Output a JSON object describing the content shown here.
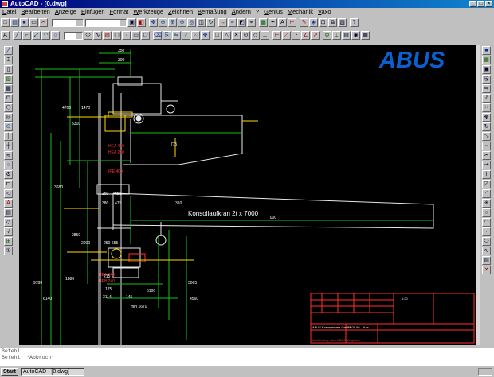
{
  "window": {
    "title": "AutoCAD - [0.dwg]"
  },
  "menu": [
    "Datei",
    "Bearbeiten",
    "Anzeige",
    "Einfügen",
    "Format",
    "Werkzeuge",
    "Zeichnen",
    "Bemaßung",
    "Ändern",
    "?",
    "Genius",
    "Mechanik",
    "Vaxo"
  ],
  "drawing": {
    "logo": "ABUS",
    "beam_label": "Konsollaufkran 2t x 7000",
    "beam_length": "7000",
    "dims_top": [
      "350",
      "300"
    ],
    "dims_left": [
      "4700",
      "5310",
      "1470",
      "3680",
      "2850",
      "6140",
      "1880",
      "9780",
      "2900"
    ],
    "dims_mid": [
      "250",
      "655",
      "475",
      "380",
      "215",
      "3065",
      "4560",
      "5100"
    ],
    "tags": [
      "HEA 400",
      "HEA 240",
      "IPE 400",
      "HEA 240",
      "HEB 240"
    ],
    "dims_lower": [
      "3114",
      "175",
      "145",
      "min 1670",
      "310",
      "250",
      "655",
      "775"
    ],
    "titleblock": {
      "company": "ABUS Kransysteme GmbH",
      "scale": "1:20",
      "date": "21.09.98",
      "drawn": "Kos",
      "footer": "Ausführung nach ABUS Vorgaben"
    }
  },
  "command": {
    "line1": "Befehl:",
    "line2": "Befehl: *Abbruch*"
  },
  "taskbar": {
    "start": "Start",
    "task": "AutoCAD - [0.dwg]"
  }
}
